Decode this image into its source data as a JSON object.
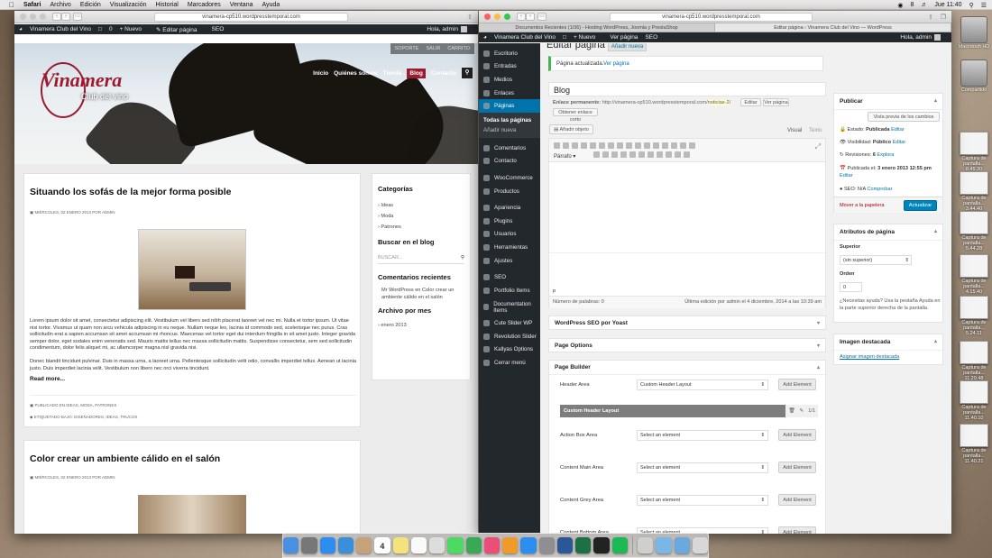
{
  "menubar": {
    "items": [
      "Safari",
      "Archivo",
      "Edición",
      "Visualización",
      "Historial",
      "Marcadores",
      "Ventana",
      "Ayuda"
    ],
    "right": [
      "8",
      "Jue 11:40"
    ]
  },
  "desktop": [
    {
      "label": "Macintosh HD",
      "type": "hd"
    },
    {
      "label": "Compartido",
      "type": "hd"
    },
    {
      "label": "Captura de pantalla... 8.45.30",
      "type": "th"
    },
    {
      "label": "Captura de pantalla... 3.44.40",
      "type": "th"
    },
    {
      "label": "Captura de pantalla... 5.44.28",
      "type": "th"
    },
    {
      "label": "Captura de pantalla... 4.15.40",
      "type": "th"
    },
    {
      "label": "Captura de pantalla... 5.24.11",
      "type": "th"
    },
    {
      "label": "Captura de pantalla... 11.29.48",
      "type": "th"
    },
    {
      "label": "Captura de pantalla... 11.40.10",
      "type": "th"
    },
    {
      "label": "Captura de pantalla... 11.40.21",
      "type": "th"
    }
  ],
  "left": {
    "url": "vinamera-cp510.wordpresstemporal.com",
    "admin": {
      "site": "Vinamera Club del Vino",
      "new": "Nuevo",
      "edit": "Editar página",
      "seo": "SEO",
      "user": "Hola, admin",
      "comments": "0"
    },
    "topnav": [
      "SOPORTE",
      "SALIR",
      "CARRITO"
    ],
    "logo": {
      "name": "Vinamera",
      "sub": "Club del vino"
    },
    "nav": [
      "Inicio",
      "Quiénes somos",
      "Tienda",
      "Blog",
      "Contacto"
    ],
    "post1": {
      "title": "Situando los sofás de la mejor forma posible",
      "meta": "MIÉRCOLES, 02 ENERO 2013 POR ADMIN",
      "p1": "Lorem ipsum dolor sit amet, consectetur adipiscing elit. Vestibulum vel libero sed nibh placerat laoreet vel nec mi. Nulla et tortor ipsum. Ut vitae nisi tortor. Vivamus ut quam non arcu vehicula adipiscing in eu neque. Nullam neque leo, lacinia id commodo sed, scelerisque nec purus. Cras sollicitudin erat a sapien accumsan sit amet accumsan mi rhoncus. Maecenas vel tortor eget dui interdum fringilla in sit amet justo. Integer gravida semper dolor, eget sodales enim venenatis sed. Mauris mattis tellus nec massa sollicitudin mattis. Suspendisse consectetur, sem sed sollicitudin condimentum, dolor felis aliquet mi, ac ullamcorper magna nisl gravida nisi.",
      "p2": "Donec blandit tincidunt pulvinar. Duis in massa urna, a laoreet urna. Pellentesque sollicitudin velit odio, convallis imperdiet tellus. Aenean ut lacinia justo. Duis imperdiet lacinia velit. Vestibulum non libero nec orci viverra tincidunt.",
      "readmore": "Read more...",
      "pub": "PUBLICADO EN IDEAS, MODA, PATRONES",
      "tags": "ETIQUETADO BAJO: DISEÑADORES, IDEAS, TRUCOS"
    },
    "post2": {
      "title": "Color crear un ambiente cálido en el salón",
      "meta": "MIÉRCOLES, 02 ENERO 2013 POR ADMIN"
    },
    "sidebar": {
      "cat_title": "Categorías",
      "cats": [
        "Ideas",
        "Moda",
        "Patrones"
      ],
      "search_title": "Buscar en el blog",
      "search_ph": "BUSCAR...",
      "comments_title": "Comentarios recientes",
      "comment": "Mr WordPress en Color crear un ambiente cálido en el salón",
      "archive_title": "Archivo por mes",
      "archive": "enero 2013"
    }
  },
  "right": {
    "url": "vinamera-cp510.wordpresstemporal.com",
    "tabs": [
      "Documentos Recientes (1/36) - Hosting WordPress, Joomla y PrestaShop",
      "Editar página ‹ Vinamera Club del Vino — WordPress"
    ],
    "admin": {
      "site": "Vinamera Club del Vino",
      "new": "Nuevo",
      "view": "Ver página",
      "seo": "SEO",
      "user": "Hola, admin"
    },
    "menu": [
      "Escritorio",
      "Entradas",
      "Medios",
      "Enlaces",
      "Páginas",
      "Comentarios",
      "Contacto",
      "WooCommerce",
      "Productos",
      "Apariencia",
      "Plugins",
      "Usuarios",
      "Herramientas",
      "Ajustes",
      "SEO",
      "Portfolio Items",
      "Documentation Items",
      "Cute Slider WP",
      "Revolution Slider",
      "Kallyas Options",
      "Cerrar menú"
    ],
    "submenu": [
      "Todas las páginas",
      "Añadir nueva"
    ],
    "heading": "Editar página",
    "addnew": "Añadir nueva",
    "notice": "Página actualizada.",
    "notice_link": "Ver página",
    "title": "Blog",
    "permalink_label": "Enlace permanente:",
    "permalink": "http://vinamera-cp510.wordpresstemporal.com/",
    "slug": "noticias-2",
    "permalink_end": "/",
    "btn_edit": "Editar",
    "btn_view": "Ver página",
    "btn_short": "Obtener enlace corto",
    "add_media": "Añadir objeto",
    "tab_visual": "Visual",
    "tab_text": "Texto",
    "format": "Párrafo",
    "path": "p",
    "wordcount": "Número de palabras: 0",
    "lastedit": "Última edición por admin el 4 diciembre, 2014 a las 10:39 am",
    "yoast": "WordPress SEO por Yoast",
    "page_options": "Page Options",
    "page_builder": "Page Builder",
    "pb_rows": [
      {
        "label": "Header Area",
        "value": "Custom Header Layout"
      },
      {
        "label": "Action Box Area",
        "value": "Select an element"
      },
      {
        "label": "Content Main Area",
        "value": "Select an element"
      },
      {
        "label": "Content Grey Area",
        "value": "Select an element"
      },
      {
        "label": "Content Bottom Area",
        "value": "Select an element"
      }
    ],
    "pb_element": "Custom Header Layout",
    "pb_count": "1/1",
    "add_element": "Add Element",
    "publish": {
      "title": "Publicar",
      "preview": "Vista previa de los cambios",
      "status": "Estado:",
      "status_val": "Publicada",
      "edit": "Editar",
      "visibility": "Visibilidad:",
      "visibility_val": "Público",
      "revisions": "Revisiones:",
      "revisions_val": "6",
      "explore": "Explora",
      "published": "Publicada el:",
      "published_val": "3 enero 2013 12:55 pm",
      "seo": "SEO:",
      "seo_val": "N/A",
      "check": "Comprobar",
      "trash": "Mover a la papelera",
      "update": "Actualizar"
    },
    "attrs": {
      "title": "Atributos de página",
      "parent": "Superior",
      "parent_val": "(sin superior)",
      "order": "Orden",
      "order_val": "0",
      "help": "¿Necesitas ayuda? Usa la pestaña Ayuda en la parte superior derecha de la pantalla."
    },
    "featured": {
      "title": "Imagen destacada",
      "link": "Asignar imagen destacada"
    }
  },
  "dock": {
    "calendar_day": "4"
  },
  "colors": {
    "wp_blue": "#0073aa",
    "wine": "#9b1b30",
    "admin_bar": "#23282d"
  }
}
